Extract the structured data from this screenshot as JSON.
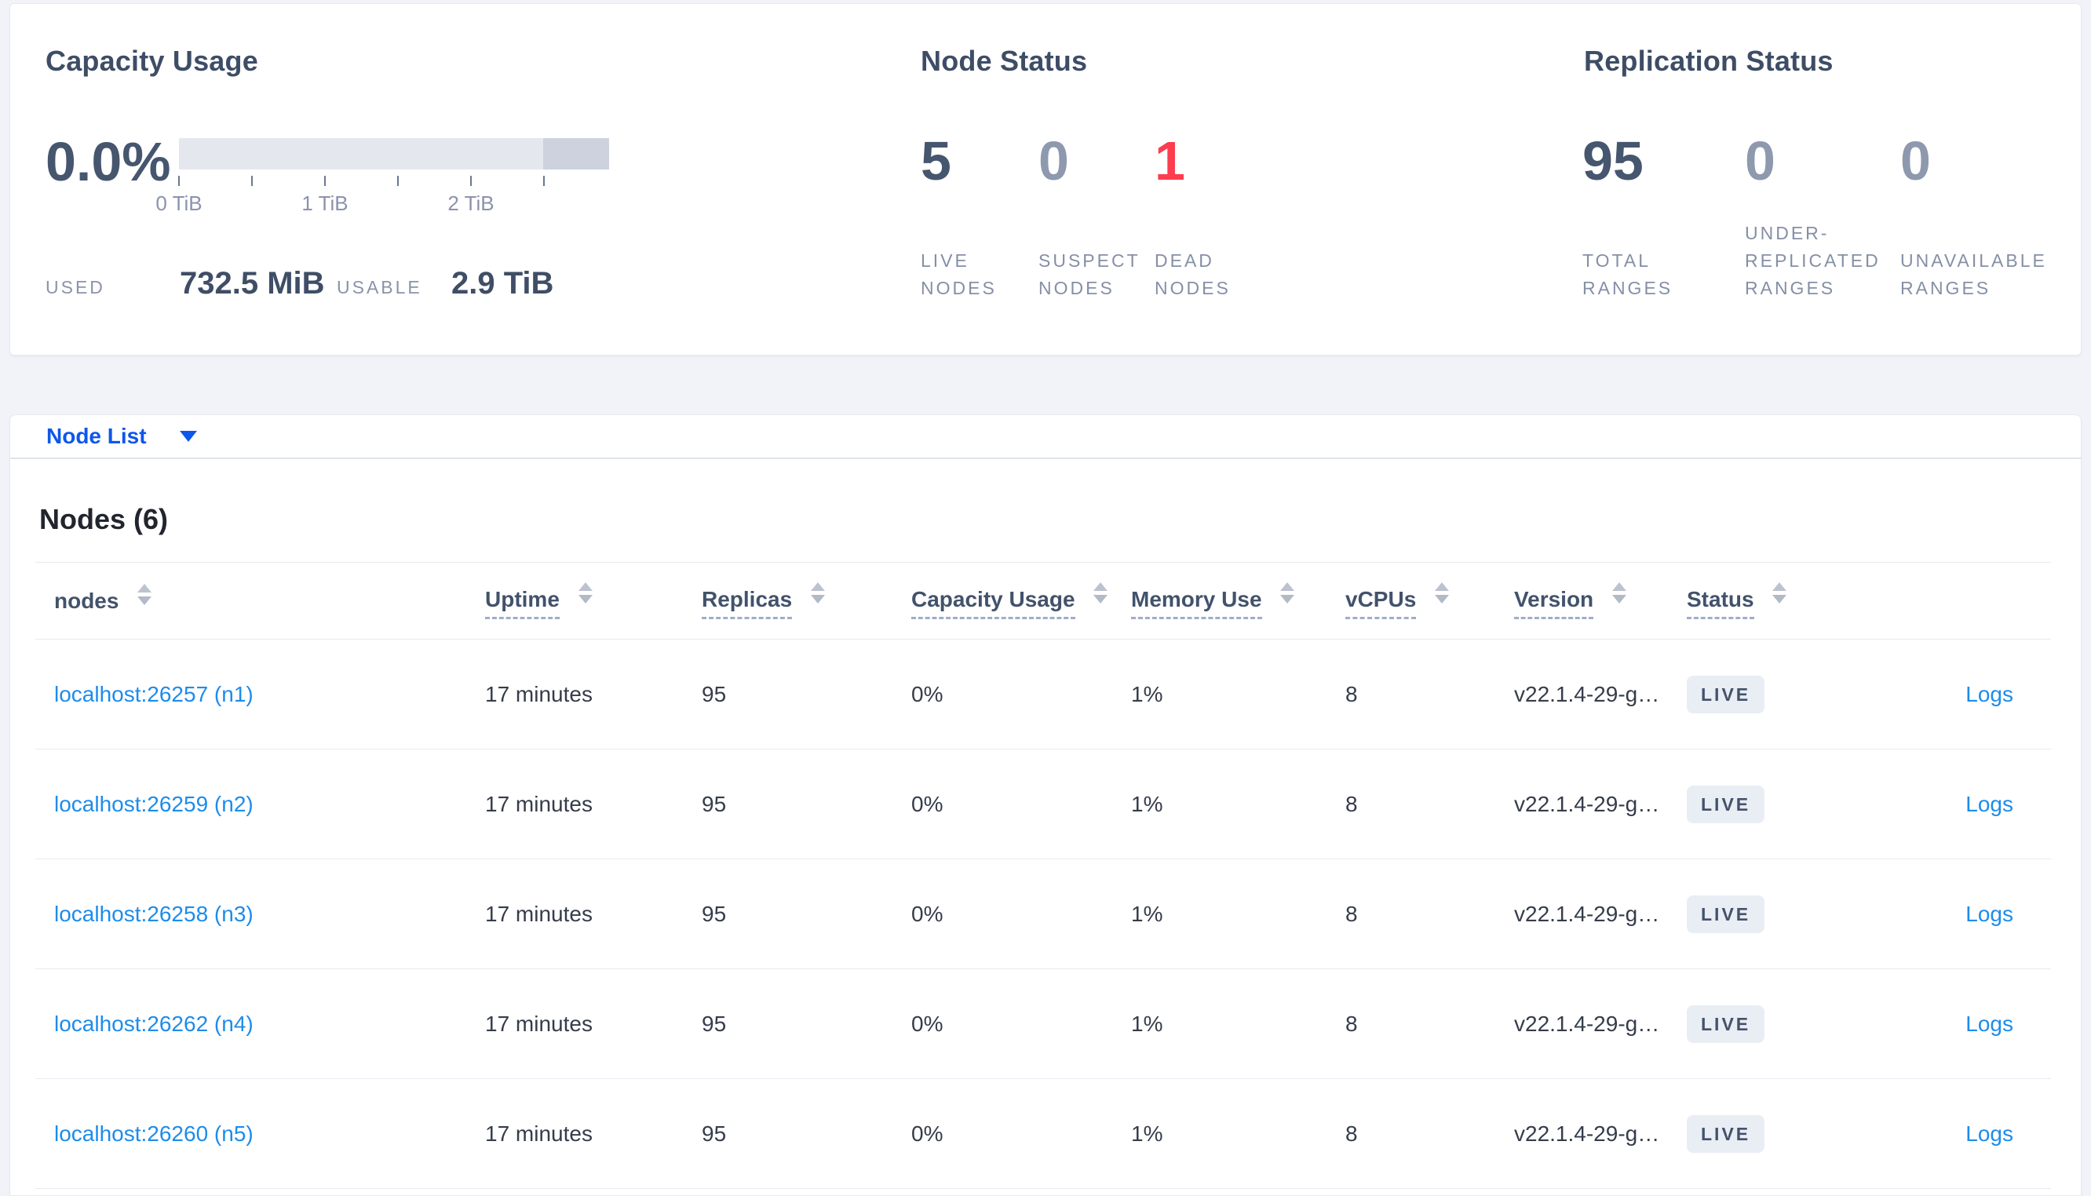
{
  "overview": {
    "capacity": {
      "title": "Capacity Usage",
      "percent": "0.0%",
      "ticks": [
        {
          "label": "0 TiB"
        },
        {
          "label": "1 TiB"
        },
        {
          "label": "2 TiB"
        }
      ],
      "used_label": "USED",
      "used_value": "732.5 MiB",
      "usable_label": "USABLE",
      "usable_value": "2.9 TiB",
      "bar": {
        "track_color": "#e4e7ee",
        "end_segment_color": "#cdd2de",
        "used_fraction": 0.0
      }
    },
    "node_status": {
      "title": "Node Status",
      "stats": [
        {
          "value": "5",
          "label": "LIVE\nNODES",
          "tone": "primary"
        },
        {
          "value": "0",
          "label": "SUSPECT\nNODES",
          "tone": "muted"
        },
        {
          "value": "1",
          "label": "DEAD\nNODES",
          "tone": "dead"
        }
      ]
    },
    "replication": {
      "title": "Replication Status",
      "stats": [
        {
          "value": "95",
          "label": "TOTAL\nRANGES",
          "tone": "primary"
        },
        {
          "value": "0",
          "label": "UNDER-\nREPLICATED\nRANGES",
          "tone": "muted"
        },
        {
          "value": "0",
          "label": "UNAVAILABLE\nRANGES",
          "tone": "muted"
        }
      ]
    }
  },
  "node_list": {
    "selector_label": "Node List",
    "heading": "Nodes (6)",
    "columns": [
      {
        "label": "nodes",
        "underline": false,
        "sortable": true
      },
      {
        "label": "Uptime",
        "underline": true,
        "sortable": true
      },
      {
        "label": "Replicas",
        "underline": true,
        "sortable": true
      },
      {
        "label": "Capacity Usage",
        "underline": true,
        "sortable": true
      },
      {
        "label": "Memory Use",
        "underline": true,
        "sortable": true
      },
      {
        "label": "vCPUs",
        "underline": true,
        "sortable": true
      },
      {
        "label": "Version",
        "underline": true,
        "sortable": true
      },
      {
        "label": "Status",
        "underline": true,
        "sortable": true
      },
      {
        "label": "",
        "underline": false,
        "sortable": false
      }
    ],
    "rows": [
      {
        "node": "localhost:26257 (n1)",
        "uptime": "17 minutes",
        "replicas": "95",
        "capacity_usage": "0%",
        "memory_use": "1%",
        "vcpus": "8",
        "version": "v22.1.4-29-g…",
        "status": "LIVE",
        "logs": "Logs"
      },
      {
        "node": "localhost:26259 (n2)",
        "uptime": "17 minutes",
        "replicas": "95",
        "capacity_usage": "0%",
        "memory_use": "1%",
        "vcpus": "8",
        "version": "v22.1.4-29-g…",
        "status": "LIVE",
        "logs": "Logs"
      },
      {
        "node": "localhost:26258 (n3)",
        "uptime": "17 minutes",
        "replicas": "95",
        "capacity_usage": "0%",
        "memory_use": "1%",
        "vcpus": "8",
        "version": "v22.1.4-29-g…",
        "status": "LIVE",
        "logs": "Logs"
      },
      {
        "node": "localhost:26262 (n4)",
        "uptime": "17 minutes",
        "replicas": "95",
        "capacity_usage": "0%",
        "memory_use": "1%",
        "vcpus": "8",
        "version": "v22.1.4-29-g…",
        "status": "LIVE",
        "logs": "Logs"
      },
      {
        "node": "localhost:26260 (n5)",
        "uptime": "17 minutes",
        "replicas": "95",
        "capacity_usage": "0%",
        "memory_use": "1%",
        "vcpus": "8",
        "version": "v22.1.4-29-g…",
        "status": "LIVE",
        "logs": "Logs"
      }
    ]
  },
  "colors": {
    "page_bg": "#f1f3f8",
    "card_bg": "#ffffff",
    "card_border": "#e6e9f1",
    "title_text": "#3e4d66",
    "stat_primary": "#46566f",
    "stat_muted": "#8e99ae",
    "stat_dead": "#fc3d4e",
    "caps_label": "#858fa6",
    "selector_blue": "#0d57eb",
    "table_link_blue": "#1d8ceb",
    "row_text": "#353c4a",
    "rule": "#e7eaf0",
    "badge_bg": "#e9edf4",
    "bar_track": "#e4e7ee",
    "bar_end": "#cdd2de"
  }
}
